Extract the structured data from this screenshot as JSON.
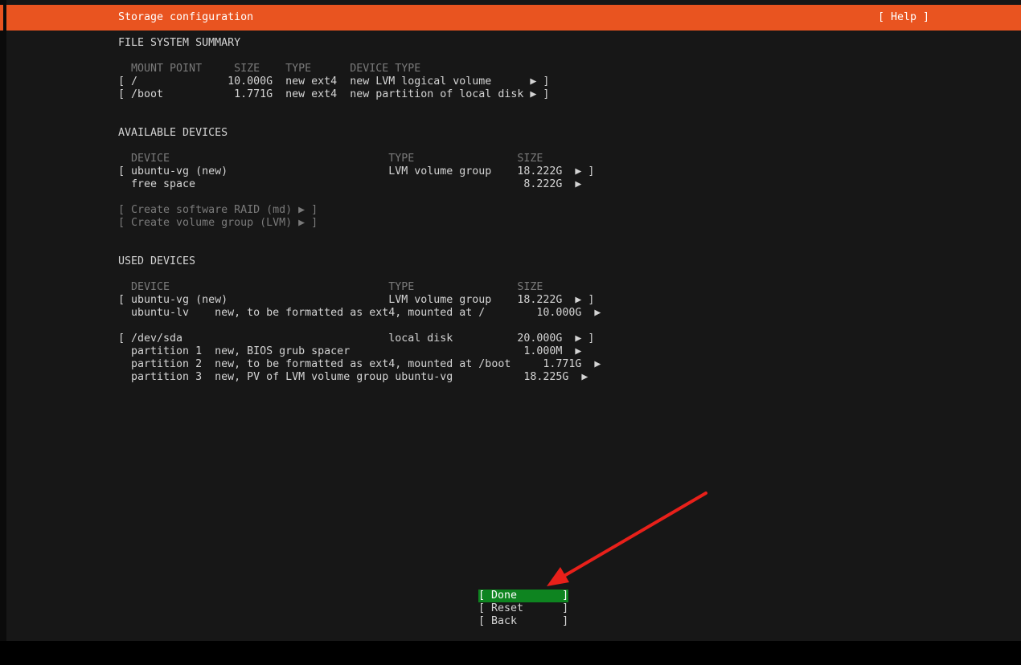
{
  "header": {
    "title": "Storage configuration",
    "help": "[ Help ]"
  },
  "fs_summary": {
    "heading": "FILE SYSTEM SUMMARY",
    "columns": "  MOUNT POINT     SIZE    TYPE      DEVICE TYPE",
    "rows": [
      "[ /              10.000G  new ext4  new LVM logical volume      ▶ ]",
      "[ /boot           1.771G  new ext4  new partition of local disk ▶ ]"
    ]
  },
  "available": {
    "heading": "AVAILABLE DEVICES",
    "columns": "  DEVICE                                  TYPE                SIZE",
    "rows": [
      "[ ubuntu-vg (new)                         LVM volume group    18.222G  ▶ ]",
      "  free space                                                   8.222G  ▶"
    ],
    "actions": [
      "[ Create software RAID (md) ▶ ]",
      "[ Create volume group (LVM) ▶ ]"
    ]
  },
  "used": {
    "heading": "USED DEVICES",
    "columns": "  DEVICE                                  TYPE                SIZE",
    "rows": [
      "[ ubuntu-vg (new)                         LVM volume group    18.222G  ▶ ]",
      "  ubuntu-lv    new, to be formatted as ext4, mounted at /        10.000G  ▶",
      "[ /dev/sda                                local disk          20.000G  ▶ ]",
      "  partition 1  new, BIOS grub spacer                           1.000M  ▶",
      "  partition 2  new, to be formatted as ext4, mounted at /boot     1.771G  ▶",
      "  partition 3  new, PV of LVM volume group ubuntu-vg           18.225G  ▶"
    ]
  },
  "buttons": {
    "done": "[ Done       ]",
    "reset": "[ Reset      ]",
    "back": "[ Back       ]"
  },
  "colors": {
    "header": "#e95420",
    "done_button": "#0e8420",
    "annotation_arrow": "#e8201a"
  }
}
